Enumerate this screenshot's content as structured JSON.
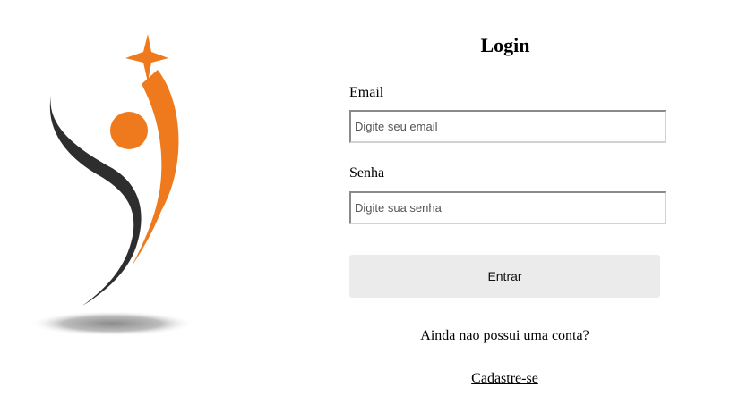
{
  "logo": {
    "icon": "person-reaching-star-logo",
    "colors": {
      "orange": "#ee7a1d",
      "dark": "#2e2e2e",
      "shadow": "#9a9a9a"
    }
  },
  "form": {
    "title": "Login",
    "email_label": "Email",
    "email_placeholder": "Digite seu email",
    "email_value": "",
    "password_label": "Senha",
    "password_placeholder": "Digite sua senha",
    "password_value": "",
    "submit_label": "Entrar"
  },
  "footer": {
    "no_account_text": "Ainda nao possui uma conta?",
    "signup_link": "Cadastre-se"
  }
}
